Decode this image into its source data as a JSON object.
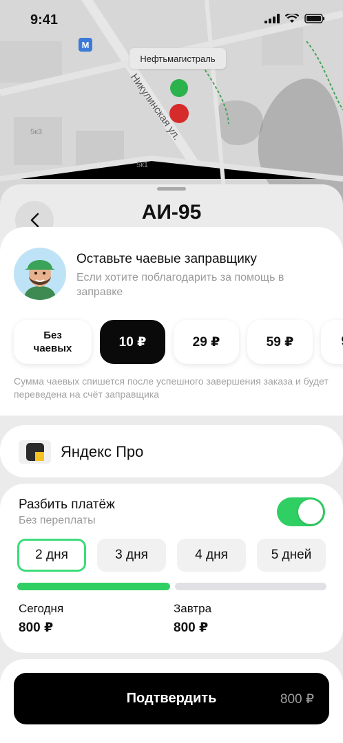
{
  "status_bar": {
    "time": "9:41"
  },
  "map": {
    "station_name": "Нефтьмагистраль",
    "street_name": "Никулинская ул.",
    "building_labels": [
      "5к3",
      "5к1"
    ],
    "metro_symbol": "M",
    "pin_colors": {
      "green": "#2bb24c",
      "red": "#d62b2b"
    }
  },
  "fuel_sheet": {
    "title": "АИ-95"
  },
  "tips": {
    "title": "Оставьте чаевые заправщику",
    "subtitle": "Если хотите поблагодарить за помощь в заправке",
    "options": [
      {
        "label": "Без чаевых",
        "selected": false
      },
      {
        "label": "10 ₽",
        "selected": true
      },
      {
        "label": "29 ₽",
        "selected": false
      },
      {
        "label": "59 ₽",
        "selected": false
      },
      {
        "label": "9",
        "selected": false
      }
    ],
    "note": "Сумма чаевых спишется после успешного завершения заказа и будет переведена на счёт заправщика"
  },
  "payment_method": {
    "label": "Яндекс Про",
    "icon": "yandex-pro-logo"
  },
  "split": {
    "title": "Разбить платёж",
    "subtitle": "Без переплаты",
    "enabled": true,
    "periods": [
      {
        "label": "2 дня",
        "selected": true
      },
      {
        "label": "3 дня",
        "selected": false
      },
      {
        "label": "4 дня",
        "selected": false
      },
      {
        "label": "5 дней",
        "selected": false
      }
    ],
    "progress_paid_fraction": 0.5,
    "schedule": [
      {
        "label": "Сегодня",
        "amount": "800 ₽"
      },
      {
        "label": "Завтра",
        "amount": "800 ₽"
      }
    ],
    "colors": {
      "accent": "#2fcf64",
      "selected_border": "#3ddc7c",
      "track": "#e1e1e5"
    }
  },
  "confirm": {
    "label": "Подтвердить",
    "price": "800 ₽"
  }
}
